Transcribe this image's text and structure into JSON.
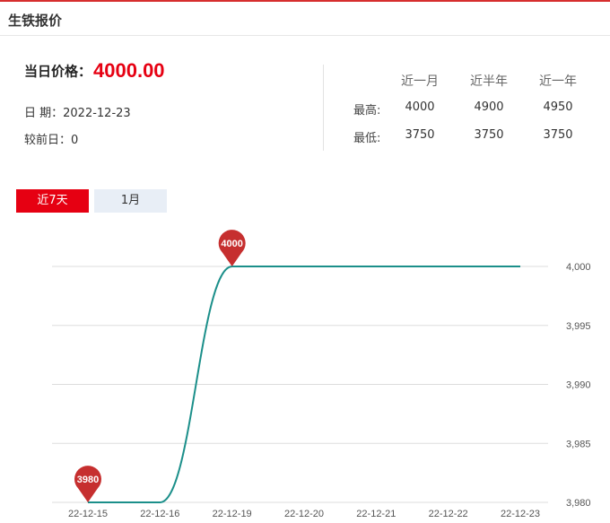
{
  "header": {
    "title": "生铁报价"
  },
  "summary": {
    "price_label": "当日价格：",
    "price_value": "4000.00",
    "date_label": "日 期：",
    "date_value": "2022-12-23",
    "change_label": "较前日：",
    "change_value": "0"
  },
  "stats": {
    "columns": [
      "近一月",
      "近半年",
      "近一年"
    ],
    "rows": [
      {
        "label": "最高:",
        "values": [
          "4000",
          "4900",
          "4950"
        ]
      },
      {
        "label": "最低:",
        "values": [
          "3750",
          "3750",
          "3750"
        ]
      }
    ]
  },
  "tabs": [
    {
      "label": "近7天",
      "active": true
    },
    {
      "label": "1月",
      "active": false
    }
  ],
  "colors": {
    "accent": "#e60012",
    "line": "#1b8f8a",
    "pin": "#c62f2f",
    "grid": "#dddddd"
  },
  "chart_data": {
    "type": "line",
    "categories": [
      "22-12-15",
      "22-12-16",
      "22-12-19",
      "22-12-20",
      "22-12-21",
      "22-12-22",
      "22-12-23"
    ],
    "values": [
      3980,
      3980,
      4000,
      4000,
      4000,
      4000,
      4000
    ],
    "y_ticks": [
      "3,980",
      "3,985",
      "3,990",
      "3,995",
      "4,000"
    ],
    "ylim": [
      3980,
      4000
    ],
    "markers": [
      {
        "label": "3980",
        "index": 0
      },
      {
        "label": "4000",
        "index": 2
      }
    ],
    "grid": true,
    "y_axis_side": "right",
    "title": "",
    "xlabel": "",
    "ylabel": ""
  }
}
